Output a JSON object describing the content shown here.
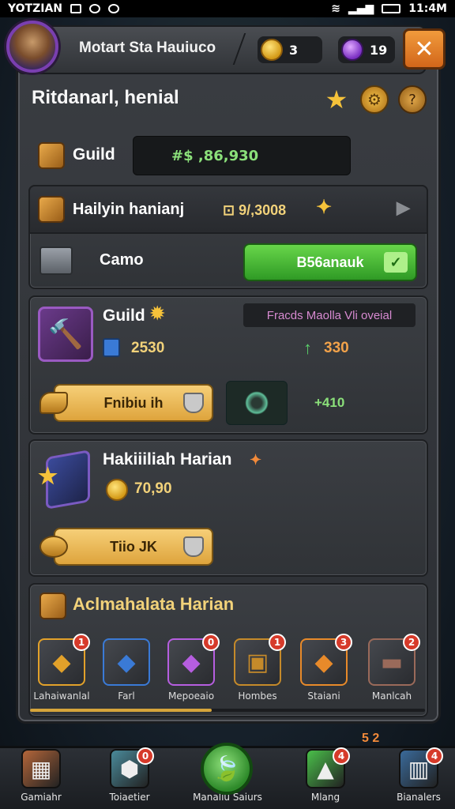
{
  "status_bar": {
    "left_text": "YOTZIAN",
    "time": "11:4M"
  },
  "top_bar": {
    "title": "Motart Sta Hauiuco",
    "coins": "3",
    "gems": "19"
  },
  "header": {
    "title": "Ritdanarl, henial"
  },
  "guild_row": {
    "label": "Guild",
    "value": "#$ ,86,930"
  },
  "section1": {
    "title": "Hailyin hanianj",
    "value": "⊡ 9/,3008",
    "chest_label": "Camo",
    "button_label": "B56anauk"
  },
  "section2": {
    "title": "Guild",
    "stat": "2530",
    "tag": "Fracds Maolla Vli oveial",
    "bonus": "330",
    "button_label": "Fnibiu ih",
    "slot_value": "+410"
  },
  "section3": {
    "title": "Hakiiiliah Harian",
    "value": "70,90",
    "button_label": "Tiio JK"
  },
  "section4": {
    "title": "Aclmahalata Harian",
    "rewards": [
      {
        "label": "Lahaiwanlal",
        "badge": "1",
        "color": "#e2a12a"
      },
      {
        "label": "Farl",
        "badge": "",
        "color": "#3a7ad6"
      },
      {
        "label": "Mepoeaio",
        "badge": "0",
        "color": "#b65ee0"
      },
      {
        "label": "Hombes",
        "badge": "1",
        "color": "#c58a2a"
      },
      {
        "label": "Staiani",
        "badge": "3",
        "color": "#e88a2a"
      },
      {
        "label": "Manlcah",
        "badge": "2",
        "color": "#9a6a5a"
      }
    ],
    "progress": 0.46,
    "counter": "5 2"
  },
  "bottom_nav": [
    {
      "label": "Gamiahr",
      "badge": ""
    },
    {
      "label": "Toiaetier",
      "badge": "0"
    },
    {
      "label": "Manaliu Saiurs",
      "badge": ""
    },
    {
      "label": "Mlang",
      "badge": "4"
    },
    {
      "label": "Bianalers",
      "badge": "4"
    }
  ]
}
